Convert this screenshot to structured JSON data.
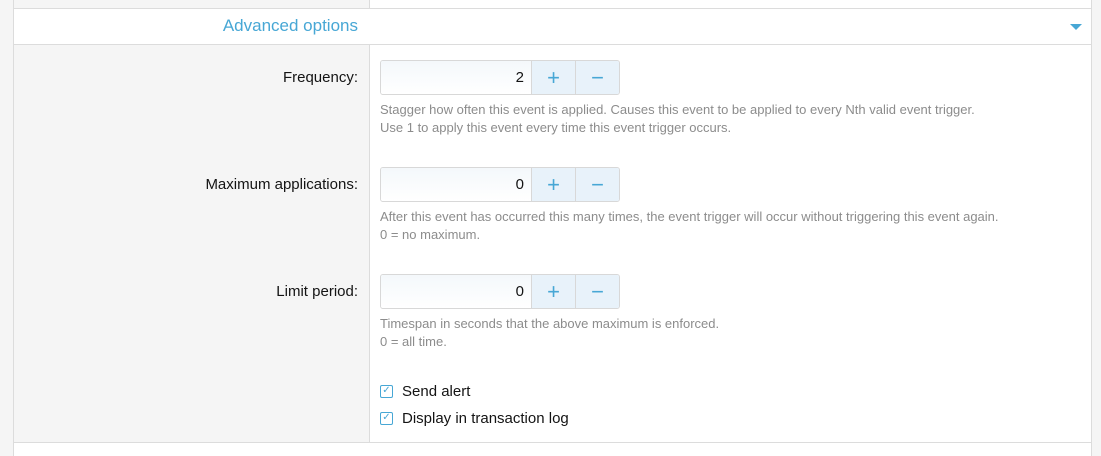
{
  "section": {
    "title": "Advanced options",
    "toggle_icon": "caret-down-icon",
    "accent_color": "#47a7d5"
  },
  "fields": [
    {
      "label": "Frequency:",
      "value": "2",
      "increment_label": "+",
      "decrement_label": "−",
      "hint_lines": [
        "Stagger how often this event is applied. Causes this event to be applied to every Nth valid event trigger.",
        "Use 1 to apply this event every time this event trigger occurs."
      ]
    },
    {
      "label": "Maximum applications:",
      "value": "0",
      "increment_label": "+",
      "decrement_label": "−",
      "hint_lines": [
        "After this event has occurred this many times, the event trigger will occur without triggering this event again.",
        "0 = no maximum."
      ]
    },
    {
      "label": "Limit period:",
      "value": "0",
      "increment_label": "+",
      "decrement_label": "−",
      "hint_lines": [
        "Timespan in seconds that the above maximum is enforced.",
        "0 = all time."
      ]
    }
  ],
  "checkboxes": [
    {
      "label": "Send alert",
      "checked": true,
      "check_icon": "checkmark-icon"
    },
    {
      "label": "Display in transaction log",
      "checked": true,
      "check_icon": "checkmark-icon"
    }
  ]
}
